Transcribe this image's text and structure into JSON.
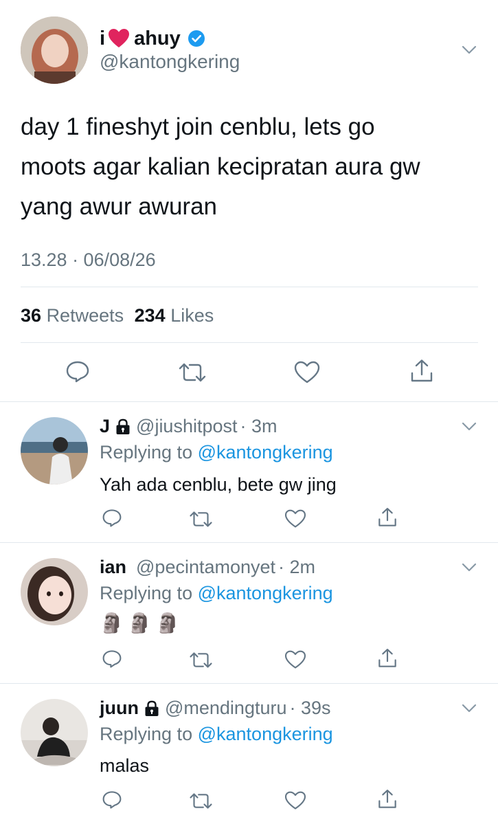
{
  "main_tweet": {
    "name_prefix": "i",
    "name_suffix": "ahuy",
    "handle": "@kantongkering",
    "text_lines": [
      "day 1 fineshyt join cenblu, lets go",
      "moots agar kalian kecipratan aura gw",
      "yang awur awuran"
    ],
    "timestamp": "13.28 · 06/08/26",
    "retweets_count": "36",
    "retweets_label": "Retweets",
    "likes_count": "234",
    "likes_label": "Likes"
  },
  "replies": [
    {
      "name": "J",
      "locked": true,
      "handle": "@jiushitpost",
      "time": "· 3m",
      "replying_prefix": "Replying to",
      "replying_handle": "@kantongkering",
      "text": "Yah ada cenblu, bete gw jing"
    },
    {
      "name": "ian",
      "locked": false,
      "handle": "@pecintamonyet",
      "time": "· 2m",
      "replying_prefix": "Replying to",
      "replying_handle": "@kantongkering",
      "text": "🗿🗿🗿"
    },
    {
      "name": "juun",
      "locked": true,
      "handle": "@mendingturu",
      "time": "· 39s",
      "replying_prefix": "Replying to",
      "replying_handle": "@kantongkering",
      "text": "malas"
    }
  ],
  "colors": {
    "link_blue": "#1b95e0",
    "secondary_gray": "#66757f",
    "verified_blue": "#1d9bf0",
    "heart_red": "#e0245e",
    "divider": "#e1e8ed"
  },
  "icons": {
    "reply": "speech-bubble-icon",
    "retweet": "retweet-arrows-icon",
    "like": "heart-icon",
    "share": "share-arrow-icon",
    "more": "chevron-down-icon",
    "verified": "verified-badge-icon",
    "locked": "lock-icon"
  }
}
